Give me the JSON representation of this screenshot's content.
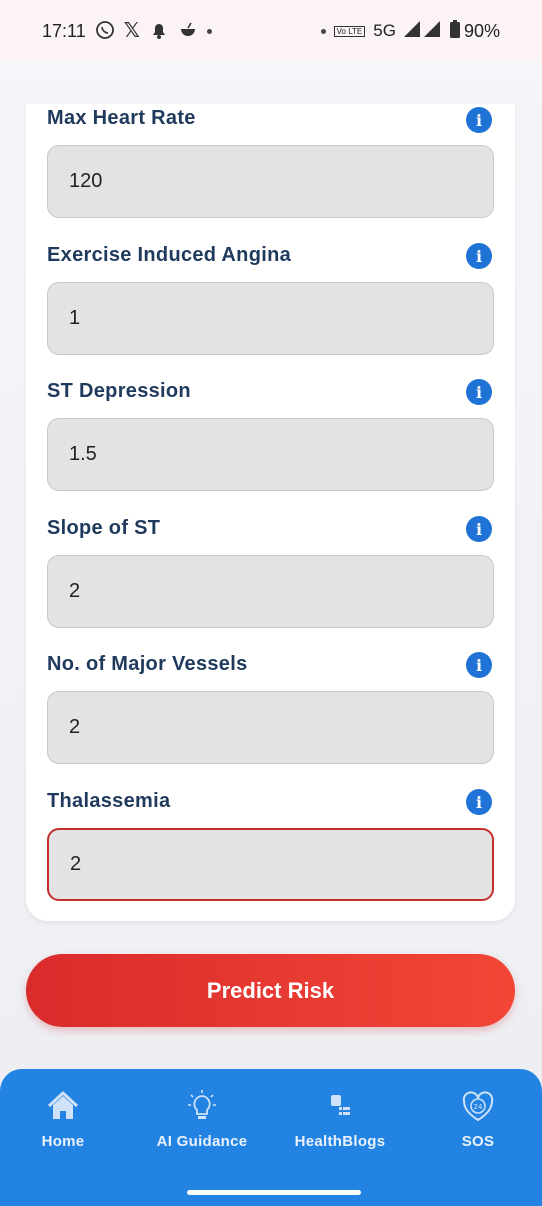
{
  "status_bar": {
    "time": "17:11",
    "network": "5G",
    "battery": "90%",
    "volte": "Vo LTE"
  },
  "form": {
    "fields": [
      {
        "label": "Max Heart Rate",
        "value": "120"
      },
      {
        "label": "Exercise Induced Angina",
        "value": "1"
      },
      {
        "label": "ST Depression",
        "value": "1.5"
      },
      {
        "label": "Slope of ST",
        "value": "2"
      },
      {
        "label": "No. of Major Vessels",
        "value": "2"
      },
      {
        "label": "Thalassemia",
        "value": "2"
      }
    ],
    "info_glyph": "i",
    "active_field": "Thalassemia"
  },
  "actions": {
    "predict_label": "Predict Risk"
  },
  "bottom_nav": {
    "items": [
      {
        "label": "Home",
        "icon": "home-icon"
      },
      {
        "label": "AI Guidance",
        "icon": "lightbulb-icon"
      },
      {
        "label": "HealthBlogs",
        "icon": "blog-icon"
      },
      {
        "label": "SOS",
        "icon": "sos-24-icon"
      }
    ]
  },
  "colors": {
    "accent": "#2383e2",
    "danger": "#d92b2b",
    "label": "#1f3a5c"
  }
}
